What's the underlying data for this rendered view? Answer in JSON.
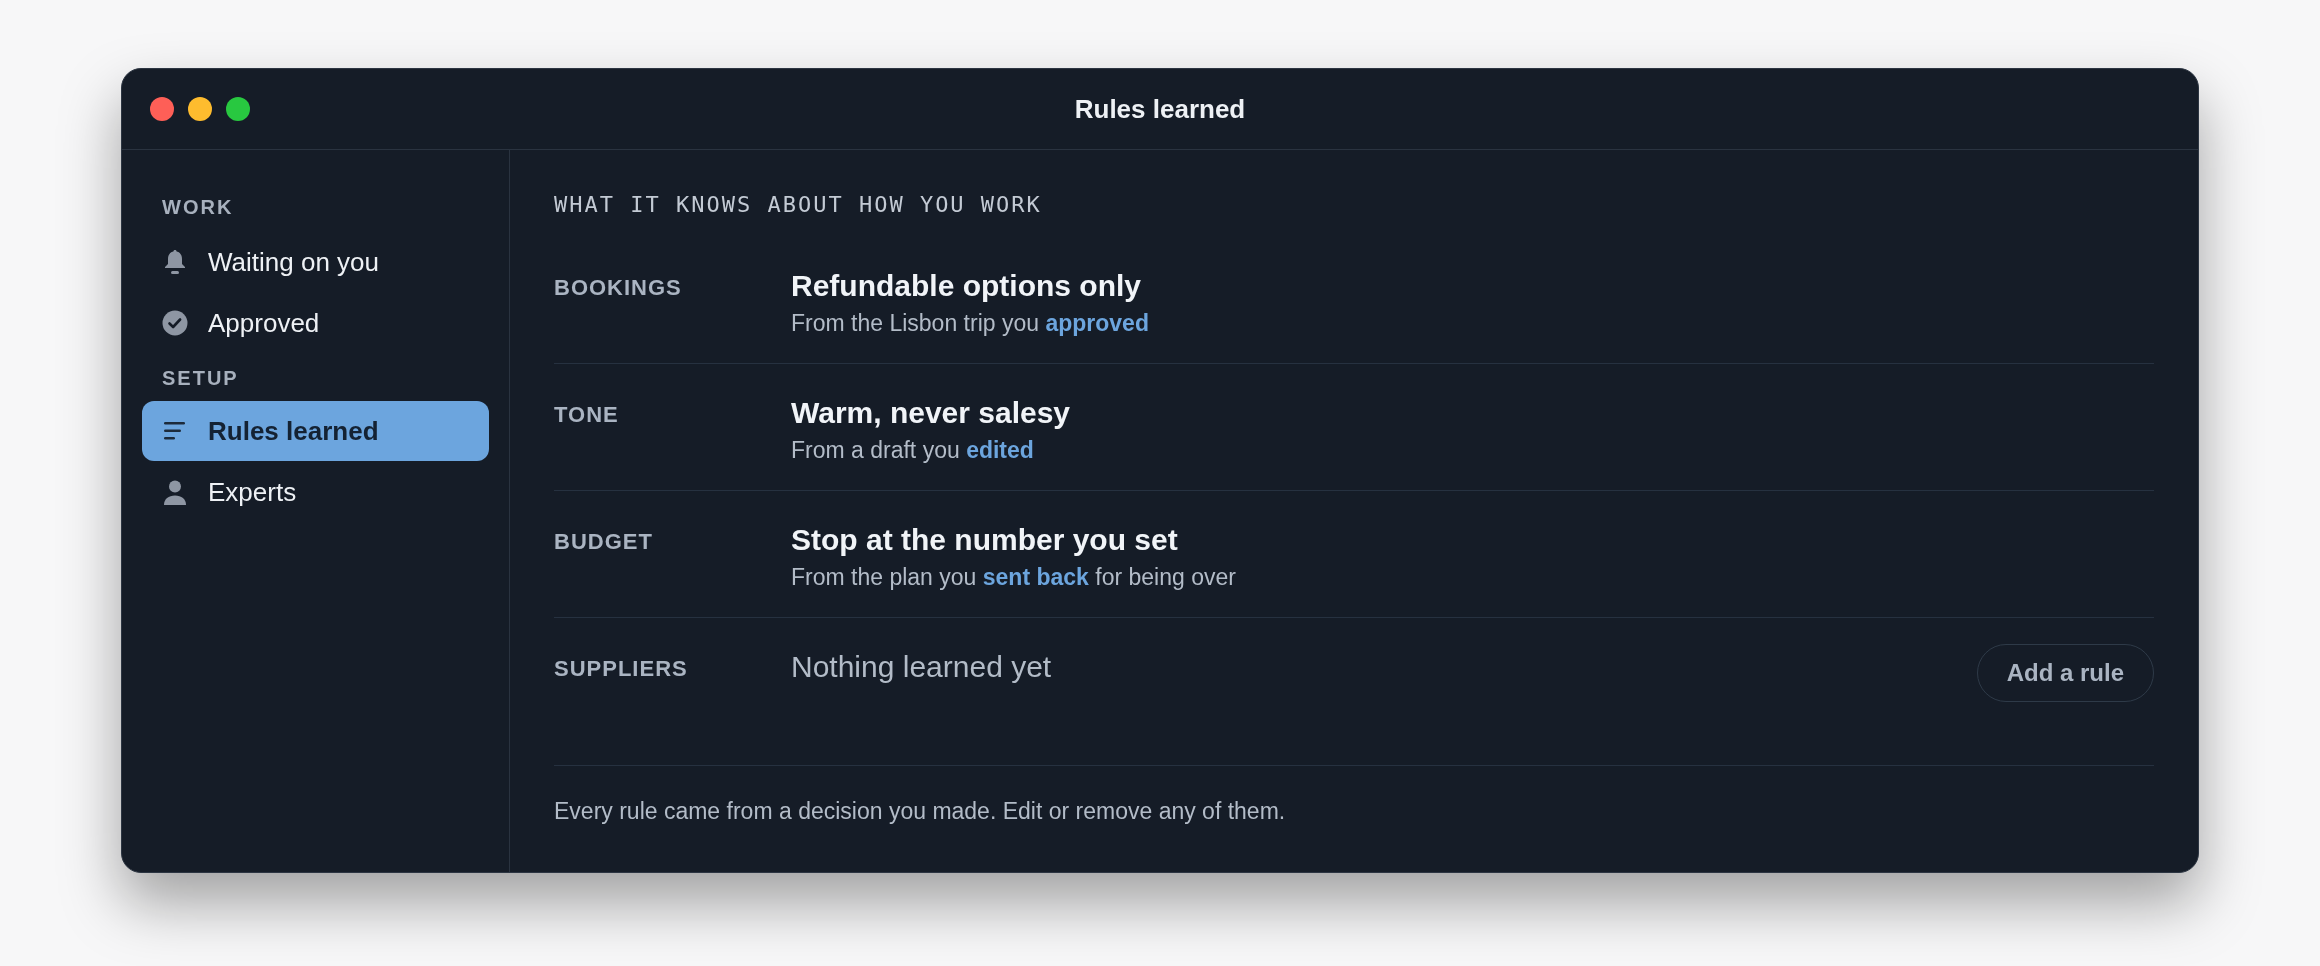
{
  "window": {
    "title": "Rules learned"
  },
  "sidebar": {
    "sections": [
      {
        "label": "WORK",
        "items": [
          {
            "label": "Waiting on you",
            "selected": false
          },
          {
            "label": "Approved",
            "selected": false
          }
        ]
      },
      {
        "label": "SETUP",
        "items": [
          {
            "label": "Rules learned",
            "selected": true
          },
          {
            "label": "Experts",
            "selected": false
          }
        ]
      }
    ]
  },
  "content": {
    "heading": "WHAT IT KNOWS ABOUT HOW YOU WORK",
    "rules": [
      {
        "kind": "rule",
        "category": "BOOKINGS",
        "title": "Refundable options only",
        "source_before": "From the Lisbon trip you",
        "source_link": "approved"
      },
      {
        "kind": "rule",
        "category": "TONE",
        "title": "Warm, never salesy",
        "source_before": "From a draft you",
        "source_link": "edited"
      },
      {
        "kind": "rule",
        "category": "BUDGET",
        "title": "Stop at the number you set",
        "source_before": "From the plan you",
        "source_link": "sent back",
        "source_after": "for being over"
      },
      {
        "kind": "empty",
        "category": "SUPPLIERS",
        "title": "Nothing learned yet",
        "button": "Add a rule"
      }
    ],
    "footer": "Every rule came from a decision you made. Edit or remove any of them."
  }
}
